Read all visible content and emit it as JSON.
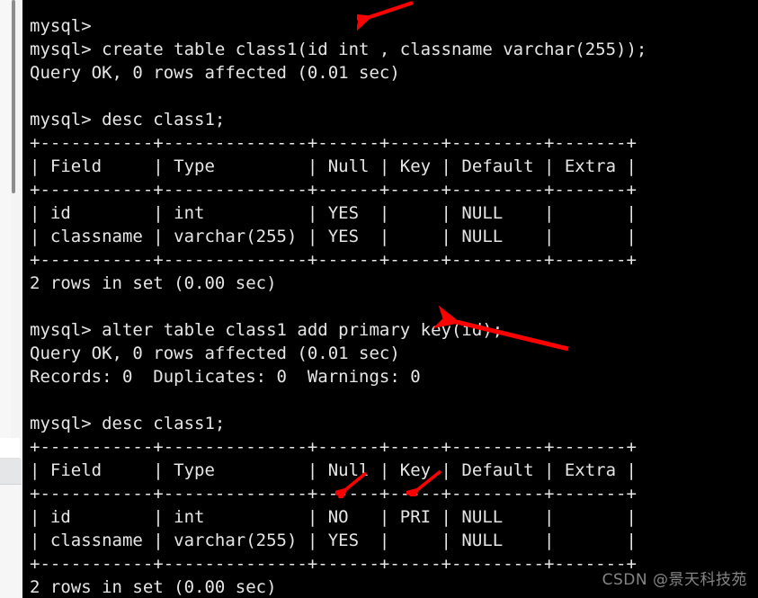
{
  "window": {
    "background_color": "#000000",
    "text_color": "#e6e6e6",
    "gutter_color": "#f4f4f4"
  },
  "terminal": {
    "prompt": "mysql>",
    "lines": [
      "mysql>",
      "mysql> create table class1(id int , classname varchar(255));",
      "Query OK, 0 rows affected (0.01 sec)",
      "",
      "mysql> desc class1;",
      "+-----------+--------------+------+-----+---------+-------+",
      "| Field     | Type         | Null | Key | Default | Extra |",
      "+-----------+--------------+------+-----+---------+-------+",
      "| id        | int          | YES  |     | NULL    |       |",
      "| classname | varchar(255) | YES  |     | NULL    |       |",
      "+-----------+--------------+------+-----+---------+-------+",
      "2 rows in set (0.00 sec)",
      "",
      "mysql> alter table class1 add primary key(id);",
      "Query OK, 0 rows affected (0.01 sec)",
      "Records: 0  Duplicates: 0  Warnings: 0",
      "",
      "mysql> desc class1;",
      "+-----------+--------------+------+-----+---------+-------+",
      "| Field     | Type         | Null | Key | Default | Extra |",
      "+-----------+--------------+------+-----+---------+-------+",
      "| id        | int          | NO   | PRI | NULL    |       |",
      "| classname | varchar(255) | YES  |     | NULL    |       |",
      "+-----------+--------------+------+-----+---------+-------+",
      "2 rows in set (0.00 sec)"
    ],
    "commands": [
      "create table class1(id int , classname varchar(255));",
      "desc class1;",
      "alter table class1 add primary key(id);",
      "desc class1;"
    ],
    "results": {
      "create_table_status": "Query OK, 0 rows affected (0.01 sec)",
      "alter_table_status": "Query OK, 0 rows affected (0.01 sec)",
      "alter_table_records": "Records: 0  Duplicates: 0  Warnings: 0",
      "rows_in_set": "2 rows in set (0.00 sec)"
    },
    "describe_table_before": {
      "columns": [
        "Field",
        "Type",
        "Null",
        "Key",
        "Default",
        "Extra"
      ],
      "rows": [
        [
          "id",
          "int",
          "YES",
          "",
          "NULL",
          ""
        ],
        [
          "classname",
          "varchar(255)",
          "YES",
          "",
          "NULL",
          ""
        ]
      ],
      "footer": "2 rows in set (0.00 sec)"
    },
    "describe_table_after": {
      "columns": [
        "Field",
        "Type",
        "Null",
        "Key",
        "Default",
        "Extra"
      ],
      "rows": [
        [
          "id",
          "int",
          "NO",
          "PRI",
          "NULL",
          ""
        ],
        [
          "classname",
          "varchar(255)",
          "YES",
          "",
          "NULL",
          ""
        ]
      ],
      "footer": "2 rows in set (0.00 sec)"
    }
  },
  "annotations": {
    "arrow_color": "#fe0000",
    "items": [
      {
        "name": "arrow-pointing-to-int-column-type",
        "target": "int"
      },
      {
        "name": "arrow-pointing-to-primary-key-clause",
        "target": "key(id);"
      },
      {
        "name": "arrow-pointing-to-null-no",
        "target": "NO"
      },
      {
        "name": "arrow-pointing-to-key-pri",
        "target": "PRI"
      }
    ]
  },
  "watermark": {
    "text": "CSDN @景天科技苑",
    "color": "#9d9d9d"
  }
}
